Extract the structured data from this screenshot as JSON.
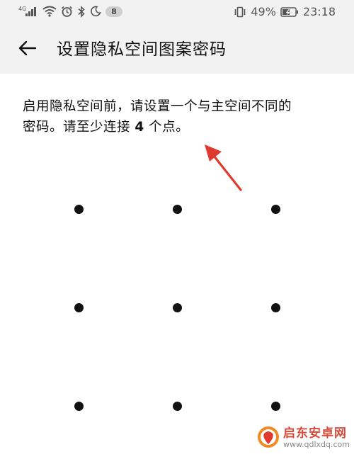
{
  "status_bar": {
    "network": "4G",
    "notification_count": "8",
    "battery_percent": "49%",
    "time": "23:18",
    "icons": [
      "signal-icon",
      "wifi-icon",
      "alarm-icon",
      "bluetooth-icon",
      "moon-icon",
      "vibrate-icon",
      "battery-icon"
    ]
  },
  "header": {
    "title": "设置隐私空间图案密码",
    "back_icon": "arrow-left-icon"
  },
  "instruction": {
    "line1": "启用隐私空间前，请设置一个与主空间不同的",
    "line2_prefix": "密码。请至少连接 ",
    "line2_bold": "4",
    "line2_suffix": " 个点。"
  },
  "pattern": {
    "rows": 3,
    "cols": 3,
    "dot_color": "#111111"
  },
  "annotation": {
    "arrow_color": "#e03a2f"
  },
  "watermark": {
    "title": "启东安卓网",
    "url": "www.qdlxdq.com",
    "brand_color": "#d64b3b"
  }
}
